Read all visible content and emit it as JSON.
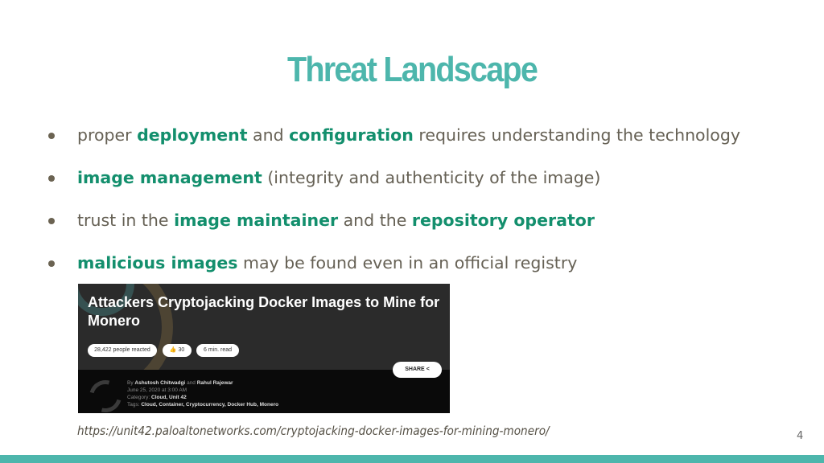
{
  "slide": {
    "title": "Threat Landscape",
    "page_number": "4",
    "accent_color": "#4db6ac",
    "highlight_color": "#138f6d"
  },
  "bullets": [
    {
      "parts": [
        {
          "t": "proper ",
          "h": false
        },
        {
          "t": "deployment",
          "h": true
        },
        {
          "t": " and ",
          "h": false
        },
        {
          "t": "configuration",
          "h": true
        },
        {
          "t": " requires understanding the technology",
          "h": false
        }
      ]
    },
    {
      "parts": [
        {
          "t": "image management",
          "h": true
        },
        {
          "t": " (integrity and authenticity of the image)",
          "h": false
        }
      ]
    },
    {
      "parts": [
        {
          "t": "trust in the ",
          "h": false
        },
        {
          "t": "image maintainer",
          "h": true
        },
        {
          "t": " and the ",
          "h": false
        },
        {
          "t": "repository operator",
          "h": true
        }
      ]
    },
    {
      "parts": [
        {
          "t": "malicious images",
          "h": true
        },
        {
          "t": " may be found even in an official registry",
          "h": false
        }
      ]
    }
  ],
  "article": {
    "title": "Attackers Cryptojacking Docker Images to Mine for Monero",
    "reactions": "28,422 people reacted",
    "likes": "30",
    "read_time": "6 min. read",
    "share_label": "SHARE",
    "by_label": "By",
    "author1": "Ashutosh Chitwadgi",
    "and_label": "and",
    "author2": "Rahul Rajewar",
    "date": "June 25, 2020 at 3:00 AM",
    "category_label": "Category:",
    "categories": "Cloud, Unit 42",
    "tags_label": "Tags:",
    "tags": "Cloud, Container, Cryptocurrency, Docker Hub, Monero"
  },
  "source_url": "https://unit42.paloaltonetworks.com/cryptojacking-docker-images-for-mining-monero/"
}
